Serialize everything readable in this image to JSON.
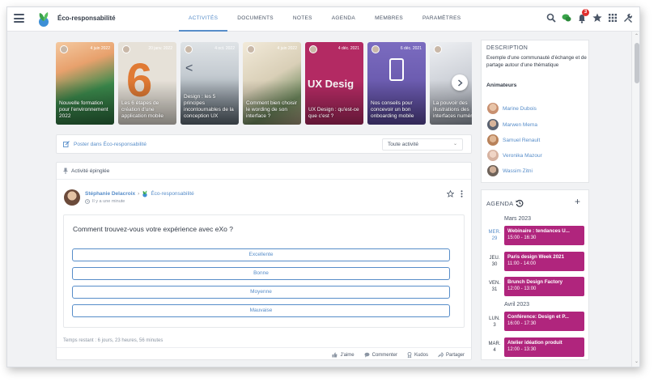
{
  "header": {
    "space_name": "Éco-responsabilité",
    "tabs": [
      "ACTIVITÉS",
      "DOCUMENTS",
      "NOTES",
      "AGENDA",
      "MEMBRES",
      "PARAMÈTRES"
    ],
    "active_tab": "ACTIVITÉS",
    "notification_count": "3",
    "icons": [
      "search-icon",
      "chat-icon",
      "bell-icon",
      "star-icon",
      "apps-grid-icon",
      "tools-icon"
    ]
  },
  "carousel": {
    "cards": [
      {
        "date": "4 juin 2022",
        "title": "Nouvelle formation pour l'environnement 2022",
        "color": "#2d6e3e"
      },
      {
        "date": "20 janv. 2022",
        "title": "Les 6 étapes de création d'une application mobile",
        "color": "#d9702f"
      },
      {
        "date": "4 oct. 2022",
        "title": "Design : les 5 principes incontournables de la conception UX",
        "color": "#5e6a75"
      },
      {
        "date": "4 juin 2022",
        "title": "Comment bien choisir le wording de son interface ?",
        "color": "#a89a7e"
      },
      {
        "date": "4 déc. 2021",
        "title": "UX Design : qu'est-ce que c'est ?",
        "color": "#a8235a"
      },
      {
        "date": "6 déc. 2021",
        "title": "Nos conseils pour concevoir un bon onboarding mobile",
        "color": "#5b4a9e"
      },
      {
        "date": "",
        "title": "La pouvoir des illustrations des interfaces numériques",
        "color": "#c3c7cf"
      }
    ]
  },
  "composer": {
    "post_label": "Poster dans Éco-responsabilité",
    "filter_value": "Toute activité"
  },
  "activity": {
    "pinned_label": "Activité épinglée",
    "author": "Stéphanie Delacroix",
    "space": "Éco-responsabilité",
    "time": "Il y a une minute",
    "poll_question": "Comment trouvez-vous votre expérience avec eXo ?",
    "options": [
      "Excellente",
      "Bonne",
      "Moyenne",
      "Mauvaise"
    ],
    "remaining": "Temps restant : 6 jours, 23 heures, 56 minutes",
    "actions": [
      "J'aime",
      "Commenter",
      "Kudos",
      "Partager"
    ]
  },
  "description": {
    "title": "DESCRIPTION",
    "text": "Exemple d'une communauté d'échange et de partage autour d'une thématique",
    "animators_title": "Animateurs",
    "animators": [
      {
        "name": "Marine Dubois",
        "color": "#c89070"
      },
      {
        "name": "Marwen Mema",
        "color": "#5a6270"
      },
      {
        "name": "Samuel Renault",
        "color": "#b8825a"
      },
      {
        "name": "Veronika Mazour",
        "color": "#d6b2a0"
      },
      {
        "name": "Wassim Zitni",
        "color": "#6e6259"
      }
    ]
  },
  "agenda": {
    "title": "AGENDA",
    "months": [
      {
        "name": "Mars 2023",
        "events": [
          {
            "weekday": "MER.",
            "day": "29",
            "title": "Webinaire : tendances U...",
            "time": "15:00 - 16:30",
            "today": true
          },
          {
            "weekday": "JEU.",
            "day": "30",
            "title": "Paris design Week 2021",
            "time": "11:00 - 14:00",
            "today": false
          },
          {
            "weekday": "VEN.",
            "day": "31",
            "title": "Brunch Design Factory",
            "time": "12:00 - 13:00",
            "today": false
          }
        ]
      },
      {
        "name": "Avril 2023",
        "events": [
          {
            "weekday": "LUN.",
            "day": "3",
            "title": "Conférence: Design et P...",
            "time": "16:00 - 17:30",
            "today": false
          },
          {
            "weekday": "MAR.",
            "day": "4",
            "title": "Atelier idéation produit",
            "time": "12:00 - 13:30",
            "today": false
          }
        ]
      }
    ],
    "event_color": "#b0257d"
  }
}
